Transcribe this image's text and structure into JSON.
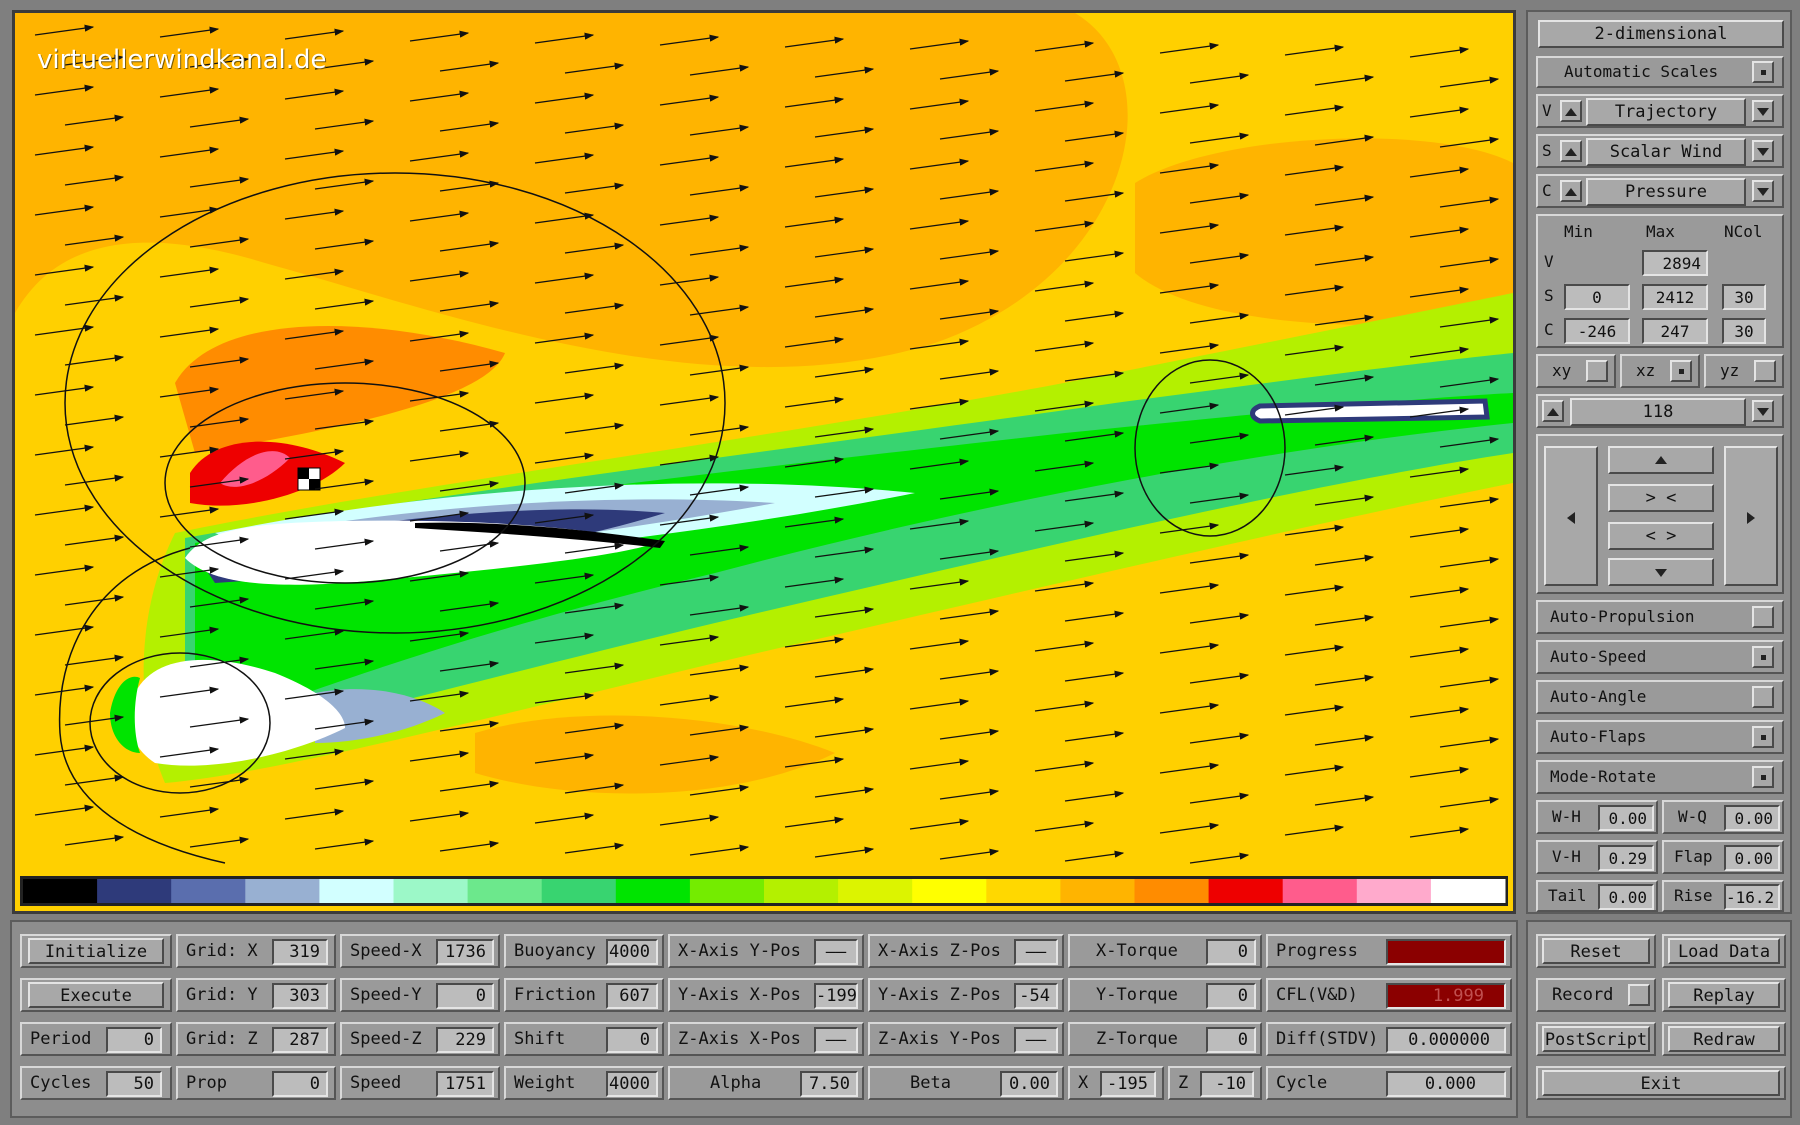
{
  "watermark": "virtuellerwindkanal.de",
  "colors": {
    "field_orange": "#FFB400",
    "field_yellow": "#FFD000",
    "progress_bar": "#8B0000",
    "cfl_bar": "#8B0000",
    "cfl_text": "#C05050"
  },
  "colorbar": [
    "#000000",
    "#2E3A7A",
    "#5A6EAE",
    "#98B0D2",
    "#D2FFFF",
    "#9CF8C8",
    "#6CE88C",
    "#38D470",
    "#00E400",
    "#74EC00",
    "#B4F000",
    "#DCF400",
    "#FFFF00",
    "#FFD800",
    "#FFB400",
    "#FF8C00",
    "#EE0000",
    "#FF5C8C",
    "#FFAACC",
    "#FFFFFF"
  ],
  "right": {
    "view_button": "2-dimensional",
    "auto_scales": "Automatic Scales",
    "v_label": "V",
    "v_select": "Trajectory",
    "s_label": "S",
    "s_select": "Scalar Wind",
    "c_label": "C",
    "c_select": "Pressure",
    "scale_headers": [
      "Min",
      "Max",
      "NCol"
    ],
    "v_max": "2894",
    "s_min": "0",
    "s_max": "2412",
    "s_ncol": "30",
    "c_min": "-246",
    "c_max": "247",
    "c_ncol": "30",
    "plane_xy": "xy",
    "plane_xz": "xz",
    "plane_yz": "yz",
    "slice_value": "118",
    "nav_zoom_in": "> <",
    "nav_zoom_out": "< >",
    "auto_propulsion": "Auto-Propulsion",
    "auto_speed": "Auto-Speed",
    "auto_angle": "Auto-Angle",
    "auto_flaps": "Auto-Flaps",
    "mode_rotate": "Mode-Rotate",
    "wh_label": "W-H",
    "wh_value": "0.00",
    "wq_label": "W-Q",
    "wq_value": "0.00",
    "vh_label": "V-H",
    "vh_value": "0.29",
    "flap_label": "Flap",
    "flap_value": "0.00",
    "tail_label": "Tail",
    "tail_value": "0.00",
    "rise_label": "Rise",
    "rise_value": "-16.2"
  },
  "bottom": {
    "initialize": "Initialize",
    "execute": "Execute",
    "period_label": "Period",
    "period_value": "0",
    "cycles_label": "Cycles",
    "cycles_value": "50",
    "gridx_label": "Grid: X",
    "gridx_value": "319",
    "gridy_label": "Grid: Y",
    "gridy_value": "303",
    "gridz_label": "Grid: Z",
    "gridz_value": "287",
    "prop_label": "Prop",
    "prop_value": "0",
    "speedx_label": "Speed-X",
    "speedx_value": "1736",
    "speedy_label": "Speed-Y",
    "speedy_value": "0",
    "speedz_label": "Speed-Z",
    "speedz_value": "229",
    "speed_label": "Speed",
    "speed_value": "1751",
    "buoyancy_label": "Buoyancy",
    "buoyancy_value": "4000",
    "friction_label": "Friction",
    "friction_value": "607",
    "shift_label": "Shift",
    "shift_value": "0",
    "weight_label": "Weight",
    "weight_value": "4000",
    "xaxis_ypos_label": "X-Axis Y-Pos",
    "xaxis_ypos_value": "——",
    "yaxis_xpos_label": "Y-Axis X-Pos",
    "yaxis_xpos_value": "-199",
    "zaxis_xpos_label": "Z-Axis X-Pos",
    "zaxis_xpos_value": "——",
    "alpha_label": "Alpha",
    "alpha_value": "7.50",
    "xaxis_zpos_label": "X-Axis Z-Pos",
    "xaxis_zpos_value": "——",
    "yaxis_zpos_label": "Y-Axis Z-Pos",
    "yaxis_zpos_value": "-54",
    "zaxis_ypos_label": "Z-Axis Y-Pos",
    "zaxis_ypos_value": "——",
    "beta_label": "Beta",
    "beta_value": "0.00",
    "xtorque_label": "X-Torque",
    "xtorque_value": "0",
    "ytorque_label": "Y-Torque",
    "ytorque_value": "0",
    "ztorque_label": "Z-Torque",
    "ztorque_value": "0",
    "x_label": "X",
    "x_value": "-195",
    "z_label": "Z",
    "z_value": "-10",
    "progress_label": "Progress",
    "progress_fraction": 1.0,
    "cfl_label": "CFL(V&D)",
    "cfl_value": "1.999",
    "diff_label": "Diff(STDV)",
    "diff_value": "0.000000",
    "cycle_label": "Cycle",
    "cycle_value": "0.000"
  },
  "actions": {
    "reset": "Reset",
    "load_data": "Load Data",
    "record": "Record",
    "replay": "Replay",
    "postscript": "PostScript",
    "redraw": "Redraw",
    "exit": "Exit"
  }
}
